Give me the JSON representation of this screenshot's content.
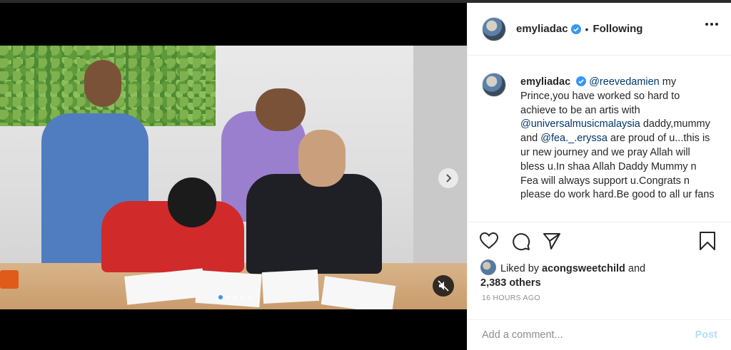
{
  "post": {
    "author": "emyliadac",
    "verified": true,
    "follow_separator": "•",
    "follow_state": "Following",
    "caption": {
      "author": "emyliadac",
      "segments": [
        {
          "type": "mention",
          "text": "@reevedamien"
        },
        {
          "type": "text",
          "text": " my Prince,you have worked so hard to achieve to be an artis with "
        },
        {
          "type": "mention",
          "text": "@universalmusicmalaysia"
        },
        {
          "type": "text",
          "text": " daddy,mummy and "
        },
        {
          "type": "mention",
          "text": "@fea._.eryssa"
        },
        {
          "type": "text",
          "text": " are proud of u...this is ur new journey and we pray Allah will bless u.In shaa Allah Daddy Mummy n Fea will always support u.Congrats n please do work hard.Be good to all ur fans"
        }
      ]
    },
    "likes": {
      "prefix": "Liked by",
      "user": "acongsweetchild",
      "connector": "and",
      "others": "2,383 others"
    },
    "timestamp": "16 HOURS AGO",
    "comment": {
      "placeholder": "Add a comment...",
      "post_label": "Post",
      "post_color": "#b2dffc"
    },
    "icons": [
      "heart-icon",
      "comment-icon",
      "share-icon",
      "bookmark-icon",
      "more-options-icon",
      "next-arrow-icon",
      "mute-icon",
      "verified-badge-icon"
    ]
  },
  "colors": {
    "mention": "#00376b",
    "verified": "#3897f0",
    "muted_text": "#8e8e8e"
  }
}
